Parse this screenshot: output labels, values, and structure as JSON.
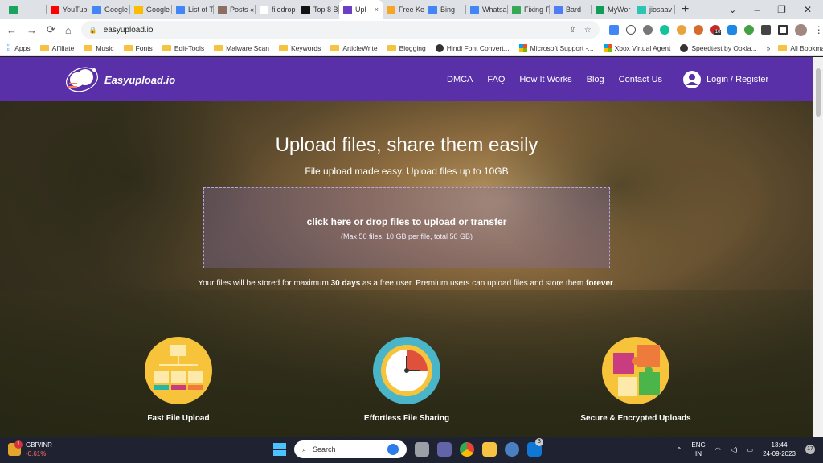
{
  "browser": {
    "tabs": [
      {
        "label": "",
        "color": "#1aa260"
      },
      {
        "label": "YouTub",
        "color": "#ff0000"
      },
      {
        "label": "Google",
        "color": "#4285f4"
      },
      {
        "label": "Google",
        "color": "#fbbc04"
      },
      {
        "label": "List of T",
        "color": "#4285f4"
      },
      {
        "label": "Posts «",
        "color": "#8d6e63"
      },
      {
        "label": "filedrop",
        "color": "#ffffff"
      },
      {
        "label": "Top 8 B",
        "color": "#111111"
      },
      {
        "label": "Upl",
        "color": "#6a3fc3",
        "active": true
      },
      {
        "label": "Free Ke",
        "color": "#f5a623"
      },
      {
        "label": "Bing",
        "color": "#4285f4"
      },
      {
        "label": "Whatsa",
        "color": "#4285f4"
      },
      {
        "label": "Fixing F",
        "color": "#34a853"
      },
      {
        "label": "Bard",
        "color": "#4f7df3"
      },
      {
        "label": "MyWor",
        "color": "#0f9d58"
      },
      {
        "label": "jiosaav",
        "color": "#2bc5b4"
      }
    ],
    "new_tab": "+",
    "close_tab": "×",
    "window_controls": {
      "chevron": "⌄",
      "minimize": "–",
      "restore": "❐",
      "close": "✕"
    },
    "nav": {
      "back": "←",
      "forward": "→",
      "reload": "⟳",
      "home": "⌂"
    },
    "url": "easyupload.io",
    "lock": "🔒",
    "share": "⇪",
    "star": "☆",
    "extension_badge": "10",
    "bookmarks": [
      {
        "label": "Apps",
        "type": "apps"
      },
      {
        "label": "Affiliate",
        "type": "folder"
      },
      {
        "label": "Music",
        "type": "folder"
      },
      {
        "label": "Fonts",
        "type": "folder"
      },
      {
        "label": "Edit-Tools",
        "type": "folder"
      },
      {
        "label": "Malware Scan",
        "type": "folder"
      },
      {
        "label": "Keywords",
        "type": "folder"
      },
      {
        "label": "ArticleWrite",
        "type": "folder"
      },
      {
        "label": "Blogging",
        "type": "folder"
      },
      {
        "label": "Hindi Font Convert...",
        "type": "site"
      },
      {
        "label": "Microsoft Support -...",
        "type": "ms"
      },
      {
        "label": "Xbox Virtual Agent",
        "type": "ms"
      },
      {
        "label": "Speedtest by Ookla...",
        "type": "site"
      }
    ],
    "bookmarks_more": "»",
    "all_bookmarks": "All Bookmarks"
  },
  "site": {
    "logo_text": "Easyupload.io",
    "nav": [
      "DMCA",
      "FAQ",
      "How It Works",
      "Blog",
      "Contact Us"
    ],
    "login_label": "Login / Register",
    "title": "Upload files, share them easily",
    "subtitle": "File upload made easy. Upload files up to 10GB",
    "dropzone_main": "click here or drop files to upload or transfer",
    "dropzone_sub": "(Max 50 files, 10 GB per file, total 50 GB)",
    "storage_note": {
      "part1": "Your files will be stored for maximum ",
      "bold1": "30 days",
      "part2": " as a free user. Premium users can upload files and store them ",
      "bold2": "forever",
      "part3": "."
    },
    "features": [
      {
        "label": "Fast File Upload",
        "icon": "sitemap-icon",
        "color": "#f6c33b"
      },
      {
        "label": "Effortless File Sharing",
        "icon": "clock-icon",
        "color": "#4ab4c8"
      },
      {
        "label": "Secure & Encrypted Uploads",
        "icon": "puzzle-icon",
        "color": "#f6c33b"
      }
    ]
  },
  "taskbar": {
    "weather_badge": "1",
    "ticker": "GBP/INR",
    "change": "-0.61%",
    "search_placeholder": "Search",
    "mail_badge": "3",
    "lang_line1": "ENG",
    "lang_line2": "IN",
    "time": "13:44",
    "date": "24-09-2023",
    "notifications": "17"
  }
}
